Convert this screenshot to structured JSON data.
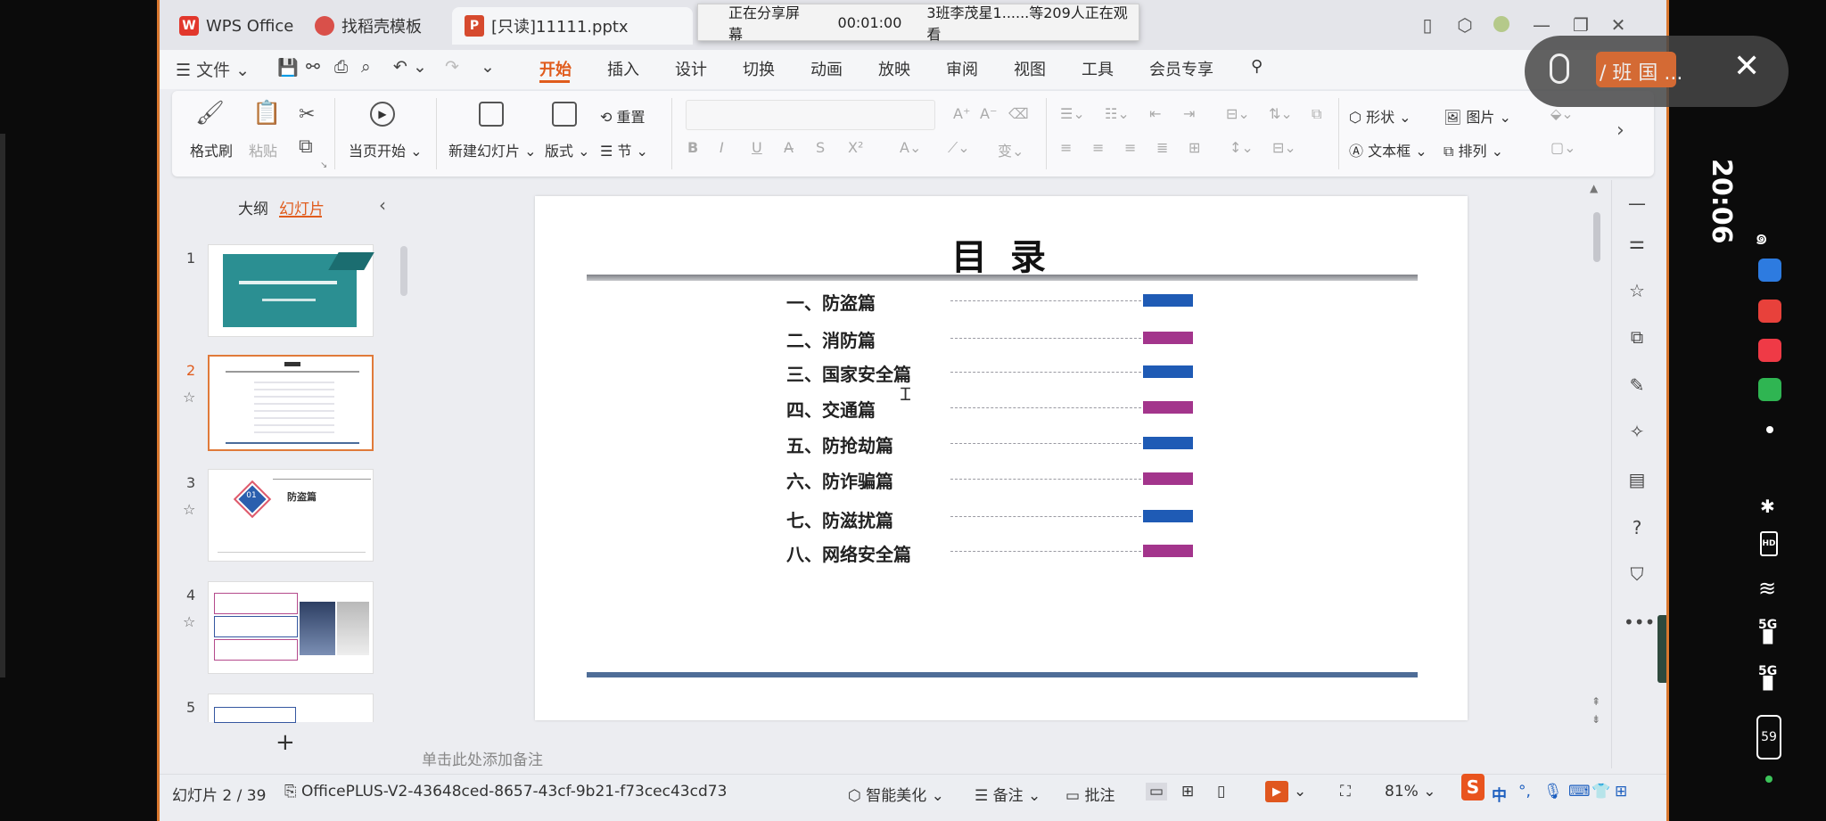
{
  "titlebar": {
    "tabs": [
      {
        "label": "WPS Office",
        "icon": "wps-logo-icon"
      },
      {
        "label": "找稻壳模板",
        "icon": "docer-icon"
      },
      {
        "label": "[只读]11111.pptx",
        "icon": "pptx-file-icon"
      }
    ]
  },
  "share_banner": {
    "status": "正在分享屏幕",
    "timer": "00:01:00",
    "viewers": "3班李茂星1......等209人正在观看"
  },
  "menu": {
    "file": "文件",
    "items": [
      "开始",
      "插入",
      "设计",
      "切换",
      "动画",
      "放映",
      "审阅",
      "视图",
      "工具",
      "会员专享"
    ],
    "active": "开始"
  },
  "ribbon": {
    "format_painter": "格式刷",
    "paste": "粘贴",
    "from_current": "当页开始",
    "new_slide": "新建幻灯片",
    "layout": "版式",
    "reset": "重置",
    "section": "节",
    "shape": "形状",
    "picture": "图片",
    "textbox": "文本框",
    "arrange": "排列"
  },
  "left_panel": {
    "tab_outline": "大纲",
    "tab_slides": "幻灯片",
    "slide_numbers": [
      "1",
      "2",
      "3",
      "4",
      "5"
    ],
    "thumb3_num": "01",
    "thumb3_title": "防盗篇",
    "add": "+"
  },
  "slide": {
    "title": "目 录",
    "items": [
      {
        "label": "一、防盗篇",
        "color": "#1f5bb5"
      },
      {
        "label": "二、消防篇",
        "color": "#a3358c"
      },
      {
        "label": "三、国家安全篇",
        "color": "#1f5bb5"
      },
      {
        "label": "四、交通篇",
        "color": "#a3358c"
      },
      {
        "label": "五、防抢劫篇",
        "color": "#1f5bb5"
      },
      {
        "label": "六、防诈骗篇",
        "color": "#a3358c"
      },
      {
        "label": "七、防滋扰篇",
        "color": "#1f5bb5"
      },
      {
        "label": "八、网络安全篇",
        "color": "#a3358c"
      }
    ],
    "notes_placeholder": "单击此处添加备注"
  },
  "statusbar": {
    "slide_count": "幻灯片 2 / 39",
    "theme_name": "OfficePLUS-V2-43648ced-8657-43cf-9b21-f73cec43cd73",
    "beautify": "智能美化",
    "notes": "备注",
    "comments": "批注",
    "zoom": "81%"
  },
  "ime": {
    "lang": "中"
  },
  "overlay": {
    "text": "/ 班 国 ..."
  },
  "phone_status": {
    "time": "20:06",
    "battery": "59",
    "network": "5G"
  }
}
